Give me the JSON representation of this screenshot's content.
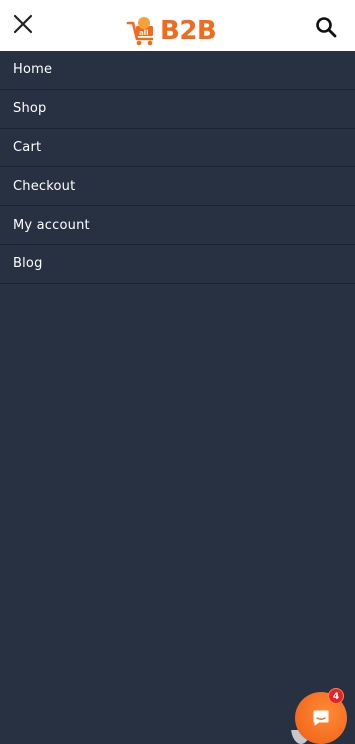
{
  "header": {
    "logo_text": "B2B",
    "close_icon": "close-icon",
    "search_icon": "search-icon",
    "brand_color": "#f26a1b"
  },
  "menu": {
    "items": [
      {
        "label": "Home"
      },
      {
        "label": "Shop"
      },
      {
        "label": "Cart"
      },
      {
        "label": "Checkout"
      },
      {
        "label": "My account"
      },
      {
        "label": "Blog"
      }
    ],
    "background": "#273142"
  },
  "chat": {
    "icon": "chat-bubble-icon",
    "badge_count": "4"
  }
}
